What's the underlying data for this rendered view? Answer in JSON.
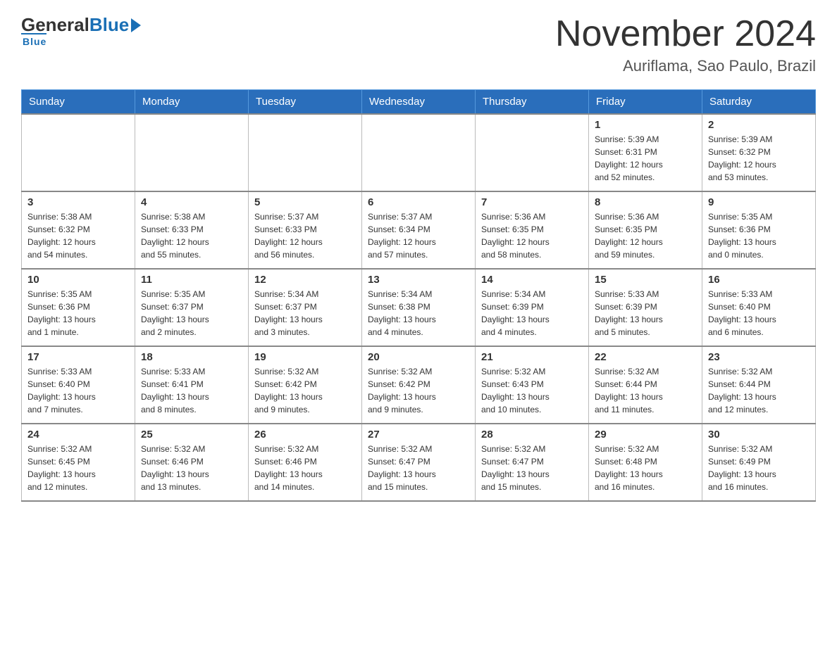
{
  "header": {
    "logo_general": "General",
    "logo_blue": "Blue",
    "month_title": "November 2024",
    "location": "Auriflama, Sao Paulo, Brazil"
  },
  "weekdays": [
    "Sunday",
    "Monday",
    "Tuesday",
    "Wednesday",
    "Thursday",
    "Friday",
    "Saturday"
  ],
  "weeks": [
    [
      {
        "day": "",
        "info": ""
      },
      {
        "day": "",
        "info": ""
      },
      {
        "day": "",
        "info": ""
      },
      {
        "day": "",
        "info": ""
      },
      {
        "day": "",
        "info": ""
      },
      {
        "day": "1",
        "info": "Sunrise: 5:39 AM\nSunset: 6:31 PM\nDaylight: 12 hours\nand 52 minutes."
      },
      {
        "day": "2",
        "info": "Sunrise: 5:39 AM\nSunset: 6:32 PM\nDaylight: 12 hours\nand 53 minutes."
      }
    ],
    [
      {
        "day": "3",
        "info": "Sunrise: 5:38 AM\nSunset: 6:32 PM\nDaylight: 12 hours\nand 54 minutes."
      },
      {
        "day": "4",
        "info": "Sunrise: 5:38 AM\nSunset: 6:33 PM\nDaylight: 12 hours\nand 55 minutes."
      },
      {
        "day": "5",
        "info": "Sunrise: 5:37 AM\nSunset: 6:33 PM\nDaylight: 12 hours\nand 56 minutes."
      },
      {
        "day": "6",
        "info": "Sunrise: 5:37 AM\nSunset: 6:34 PM\nDaylight: 12 hours\nand 57 minutes."
      },
      {
        "day": "7",
        "info": "Sunrise: 5:36 AM\nSunset: 6:35 PM\nDaylight: 12 hours\nand 58 minutes."
      },
      {
        "day": "8",
        "info": "Sunrise: 5:36 AM\nSunset: 6:35 PM\nDaylight: 12 hours\nand 59 minutes."
      },
      {
        "day": "9",
        "info": "Sunrise: 5:35 AM\nSunset: 6:36 PM\nDaylight: 13 hours\nand 0 minutes."
      }
    ],
    [
      {
        "day": "10",
        "info": "Sunrise: 5:35 AM\nSunset: 6:36 PM\nDaylight: 13 hours\nand 1 minute."
      },
      {
        "day": "11",
        "info": "Sunrise: 5:35 AM\nSunset: 6:37 PM\nDaylight: 13 hours\nand 2 minutes."
      },
      {
        "day": "12",
        "info": "Sunrise: 5:34 AM\nSunset: 6:37 PM\nDaylight: 13 hours\nand 3 minutes."
      },
      {
        "day": "13",
        "info": "Sunrise: 5:34 AM\nSunset: 6:38 PM\nDaylight: 13 hours\nand 4 minutes."
      },
      {
        "day": "14",
        "info": "Sunrise: 5:34 AM\nSunset: 6:39 PM\nDaylight: 13 hours\nand 4 minutes."
      },
      {
        "day": "15",
        "info": "Sunrise: 5:33 AM\nSunset: 6:39 PM\nDaylight: 13 hours\nand 5 minutes."
      },
      {
        "day": "16",
        "info": "Sunrise: 5:33 AM\nSunset: 6:40 PM\nDaylight: 13 hours\nand 6 minutes."
      }
    ],
    [
      {
        "day": "17",
        "info": "Sunrise: 5:33 AM\nSunset: 6:40 PM\nDaylight: 13 hours\nand 7 minutes."
      },
      {
        "day": "18",
        "info": "Sunrise: 5:33 AM\nSunset: 6:41 PM\nDaylight: 13 hours\nand 8 minutes."
      },
      {
        "day": "19",
        "info": "Sunrise: 5:32 AM\nSunset: 6:42 PM\nDaylight: 13 hours\nand 9 minutes."
      },
      {
        "day": "20",
        "info": "Sunrise: 5:32 AM\nSunset: 6:42 PM\nDaylight: 13 hours\nand 9 minutes."
      },
      {
        "day": "21",
        "info": "Sunrise: 5:32 AM\nSunset: 6:43 PM\nDaylight: 13 hours\nand 10 minutes."
      },
      {
        "day": "22",
        "info": "Sunrise: 5:32 AM\nSunset: 6:44 PM\nDaylight: 13 hours\nand 11 minutes."
      },
      {
        "day": "23",
        "info": "Sunrise: 5:32 AM\nSunset: 6:44 PM\nDaylight: 13 hours\nand 12 minutes."
      }
    ],
    [
      {
        "day": "24",
        "info": "Sunrise: 5:32 AM\nSunset: 6:45 PM\nDaylight: 13 hours\nand 12 minutes."
      },
      {
        "day": "25",
        "info": "Sunrise: 5:32 AM\nSunset: 6:46 PM\nDaylight: 13 hours\nand 13 minutes."
      },
      {
        "day": "26",
        "info": "Sunrise: 5:32 AM\nSunset: 6:46 PM\nDaylight: 13 hours\nand 14 minutes."
      },
      {
        "day": "27",
        "info": "Sunrise: 5:32 AM\nSunset: 6:47 PM\nDaylight: 13 hours\nand 15 minutes."
      },
      {
        "day": "28",
        "info": "Sunrise: 5:32 AM\nSunset: 6:47 PM\nDaylight: 13 hours\nand 15 minutes."
      },
      {
        "day": "29",
        "info": "Sunrise: 5:32 AM\nSunset: 6:48 PM\nDaylight: 13 hours\nand 16 minutes."
      },
      {
        "day": "30",
        "info": "Sunrise: 5:32 AM\nSunset: 6:49 PM\nDaylight: 13 hours\nand 16 minutes."
      }
    ]
  ]
}
